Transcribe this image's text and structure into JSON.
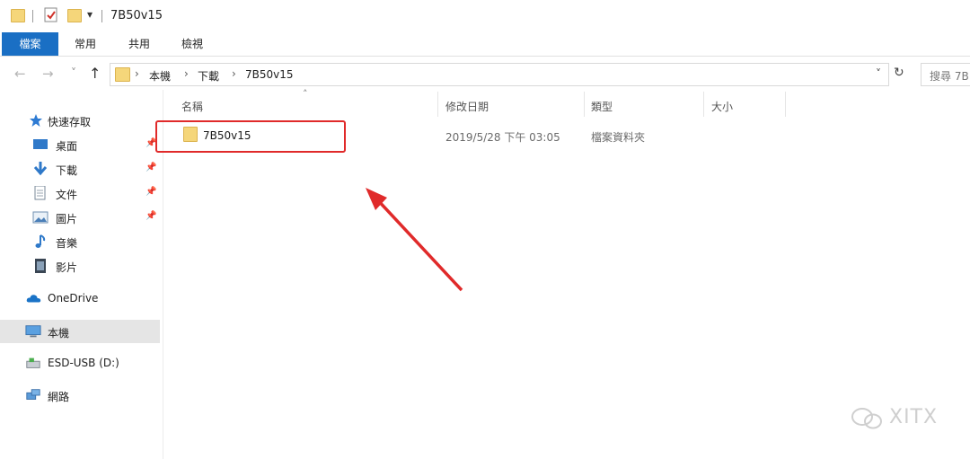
{
  "window": {
    "title": "7B50v15",
    "quick_access_dropdown": "▾"
  },
  "ribbon": {
    "tabs": [
      "檔案",
      "常用",
      "共用",
      "檢視"
    ]
  },
  "nav_controls": {
    "back": "←",
    "forward": "→",
    "recent": "˅",
    "up": "↑"
  },
  "address": {
    "crumbs": [
      "本機",
      "下載",
      "7B50v15"
    ],
    "separator": "›",
    "dropdown": "˅",
    "refresh": "↻"
  },
  "search": {
    "placeholder": "搜尋 7B"
  },
  "navigation": {
    "quick_access": "快速存取",
    "pinned": [
      {
        "label": "桌面",
        "icon": "desktop-icon"
      },
      {
        "label": "下載",
        "icon": "download-icon"
      },
      {
        "label": "文件",
        "icon": "document-icon"
      },
      {
        "label": "圖片",
        "icon": "pictures-icon"
      },
      {
        "label": "音樂",
        "icon": "music-icon"
      },
      {
        "label": "影片",
        "icon": "video-icon"
      }
    ],
    "pin_glyph": "📌",
    "onedrive": "OneDrive",
    "this_pc": "本機",
    "usb": "ESD-USB (D:)",
    "network": "網路"
  },
  "columns": {
    "name": "名稱",
    "modified": "修改日期",
    "type": "類型",
    "size": "大小",
    "sort_indicator": "˄"
  },
  "rows": [
    {
      "name": "7B50v15",
      "modified": "2019/5/28 下午 03:05",
      "type": "檔案資料夾",
      "size": ""
    }
  ],
  "watermark": "XITX",
  "colors": {
    "accent": "#1a6fc4",
    "annotation": "#e02a2a",
    "folder": "#f5d67a",
    "selected_nav": "#e5e5e5"
  }
}
